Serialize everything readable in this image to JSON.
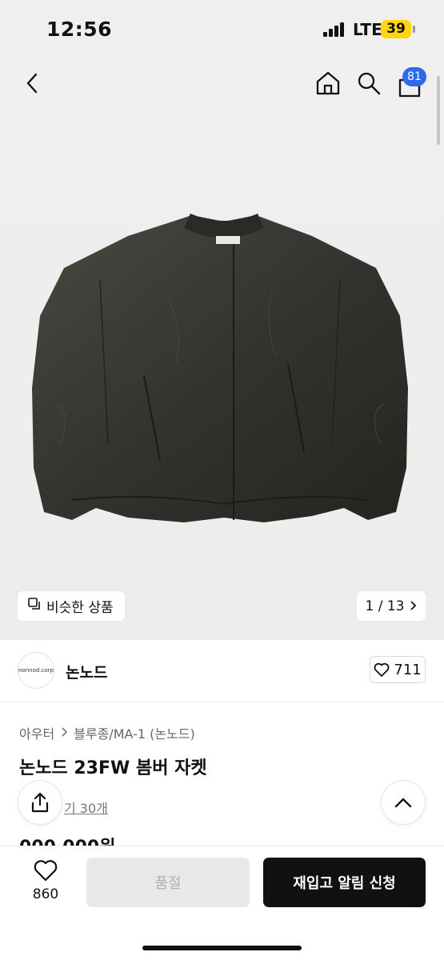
{
  "status_bar": {
    "time": "12:56",
    "network": "LTE",
    "battery": "39"
  },
  "nav": {
    "cart_count": "81"
  },
  "gallery": {
    "similar_label": "비슷한 상품",
    "pager": "1 / 13"
  },
  "store": {
    "logo_text": "nonnod.corp",
    "name": "논노드",
    "likes": "711"
  },
  "breadcrumb": {
    "level1": "아우터",
    "level2": "블루종/MA-1 (논노드)"
  },
  "product": {
    "title": "논노드 23FW 봄버 자켓",
    "reviews": "기 30개",
    "price_partial": "000,000원"
  },
  "bottom": {
    "wish_count": "860",
    "soldout_label": "품절",
    "restock_label": "재입고 알림 신청"
  },
  "colors": {
    "accent": "#2e6bea",
    "battery": "#ffd60a",
    "primary_button": "#111111",
    "disabled_button": "#e8e8e8"
  }
}
